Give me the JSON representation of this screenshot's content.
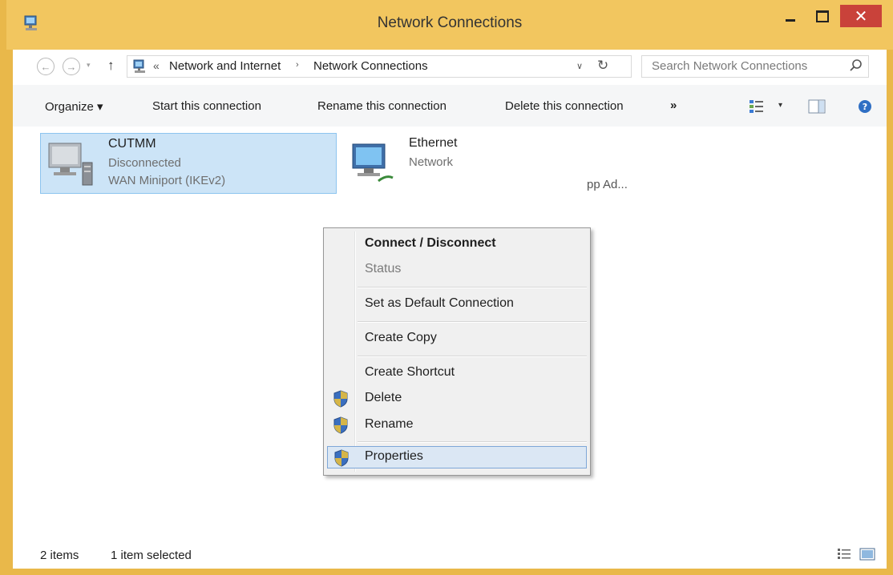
{
  "window": {
    "title": "Network Connections",
    "close_glyph": "✕"
  },
  "navigation": {
    "back_glyph": "←",
    "forward_glyph": "→",
    "dropdown_glyph": "▾",
    "up_glyph": "↑",
    "breadcrumb_chevron": "«",
    "breadcrumb_sep": "›",
    "breadcrumb": [
      "Network and Internet",
      "Network Connections"
    ],
    "address_dropdown_glyph": "∨",
    "refresh_glyph": "↻",
    "search_placeholder": "Search Network Connections"
  },
  "toolbar": {
    "organize": "Organize ▾",
    "start": "Start this connection",
    "rename": "Rename this connection",
    "delete": "Delete this connection",
    "more": "»",
    "view_dropdown": "▾"
  },
  "items": [
    {
      "name": "CUTMM",
      "status": "Disconnected",
      "device": "WAN Miniport (IKEv2)"
    },
    {
      "name": "Ethernet",
      "status": "Network",
      "device_fragment": "pp Ad..."
    }
  ],
  "context_menu": {
    "items": [
      {
        "label": "Connect / Disconnect"
      },
      {
        "label": "Status"
      },
      {
        "label": "Set as Default Connection"
      },
      {
        "label": "Create Copy"
      },
      {
        "label": "Create Shortcut"
      },
      {
        "label": "Delete"
      },
      {
        "label": "Rename"
      },
      {
        "label": "Properties"
      }
    ]
  },
  "status_bar": {
    "count": "2 items",
    "selected": "1 item selected"
  },
  "colors": {
    "titlebar": "#f2c65f",
    "close_button": "#c9423a",
    "selection": "#cce4f7"
  }
}
